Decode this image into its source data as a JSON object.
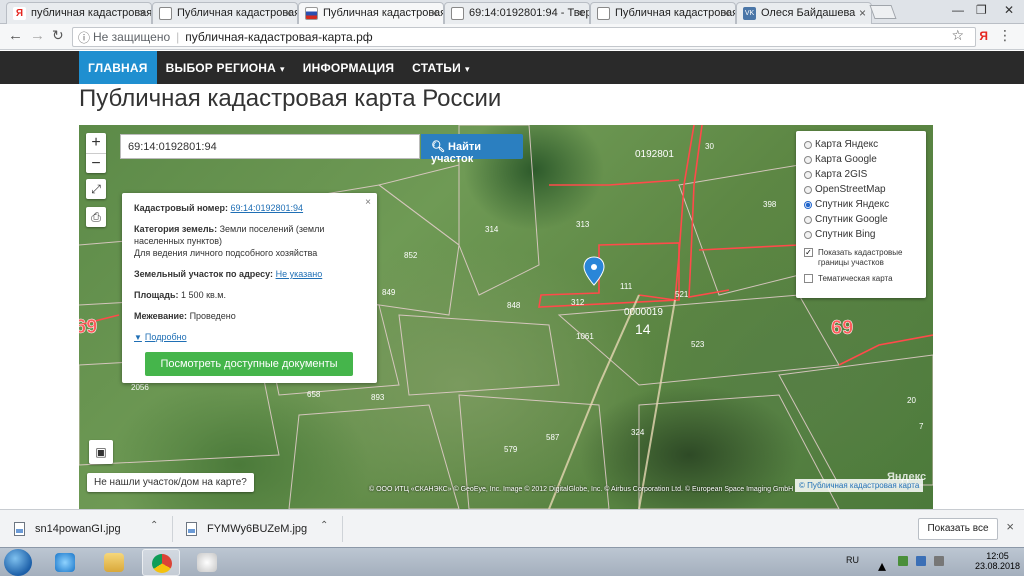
{
  "browser": {
    "tabs": [
      {
        "label": "публичная кадастровая",
        "favicon": "yandex-icon",
        "active": false
      },
      {
        "label": "Публичная кадастровая",
        "favicon": "document-icon",
        "active": false
      },
      {
        "label": "Публичная кадастровая",
        "favicon": "russian-flag-icon",
        "active": true
      },
      {
        "label": "69:14:0192801:94 - Тверь",
        "favicon": "document-icon",
        "active": false
      },
      {
        "label": "Публичная кадастровая",
        "favicon": "document-icon",
        "active": false
      },
      {
        "label": "Олеся Байдашева",
        "favicon": "vk-icon",
        "active": false
      }
    ],
    "address": {
      "security": "Не защищено",
      "url": "публичная-кадастровая-карта.рф"
    },
    "extension_label": "Я"
  },
  "site": {
    "nav": [
      {
        "label": "ГЛАВНАЯ",
        "active": true,
        "dropdown": false
      },
      {
        "label": "ВЫБОР РЕГИОНА",
        "active": false,
        "dropdown": true
      },
      {
        "label": "ИНФОРМАЦИЯ",
        "active": false,
        "dropdown": false
      },
      {
        "label": "СТАТЬИ",
        "active": false,
        "dropdown": true
      }
    ],
    "title": "Публичная кадастровая карта России"
  },
  "map": {
    "zoom_in": "+",
    "zoom_out": "−",
    "search": {
      "value": "69:14:0192801:94",
      "button_label": "Найти участок"
    },
    "popup": {
      "cadastral_label": "Кадастровый номер:",
      "cadastral_value": "69:14:0192801:94",
      "category_label": "Категория земель:",
      "category_value": "Земли поселений (земли населенных пунктов)",
      "use_value": "Для ведения личного подсобного хозяйства",
      "address_label": "Земельный участок по адресу:",
      "address_value": "Не указано",
      "area_label": "Площадь:",
      "area_value": "1 500 кв.м.",
      "survey_label": "Межевание:",
      "survey_value": "Проведено",
      "more_label": "Подробно",
      "docs_button": "Посмотреть доступные документы",
      "close": "×"
    },
    "layers": {
      "options": [
        {
          "label": "Карта Яндекс",
          "selected": false
        },
        {
          "label": "Карта Google",
          "selected": false
        },
        {
          "label": "Карта 2GIS",
          "selected": false
        },
        {
          "label": "OpenStreetMap",
          "selected": false
        },
        {
          "label": "Спутник Яндекс",
          "selected": true
        },
        {
          "label": "Спутник Google",
          "selected": false
        },
        {
          "label": "Спутник Bing",
          "selected": false
        }
      ],
      "checkboxes": [
        {
          "label": "Показать кадастровые границы участков",
          "checked": true
        },
        {
          "label": "Тематическая карта",
          "checked": false
        }
      ]
    },
    "labels": {
      "block": "0192801",
      "block2": "0000019",
      "district": "14",
      "region1": "69",
      "region2": "69",
      "parcels": [
        "30",
        "313",
        "314",
        "852",
        "849",
        "848",
        "312",
        "111",
        "521",
        "398",
        "1061",
        "523",
        "658",
        "893",
        "587",
        "324",
        "579",
        "2056",
        "20",
        "7"
      ]
    },
    "not_found_label": "Не нашли участок/дом на карте?",
    "attribution": "© ООО ИТЦ «СКАНЭКС» © GeoEye, Inc. Image © 2012 DigitalGlobe, Inc. © Airbus Corporation Ltd. © European Space Imaging GmbH",
    "pkk_link": "© Публичная кадастровая карта",
    "watermark": "Яндекс"
  },
  "downloads": {
    "items": [
      {
        "name": "sn14powanGI.jpg"
      },
      {
        "name": "FYMWy6BUZeM.jpg"
      }
    ],
    "show_all": "Показать все",
    "close": "×"
  },
  "taskbar": {
    "lang": "RU",
    "time": "12:05",
    "date": "23.08.2018"
  }
}
